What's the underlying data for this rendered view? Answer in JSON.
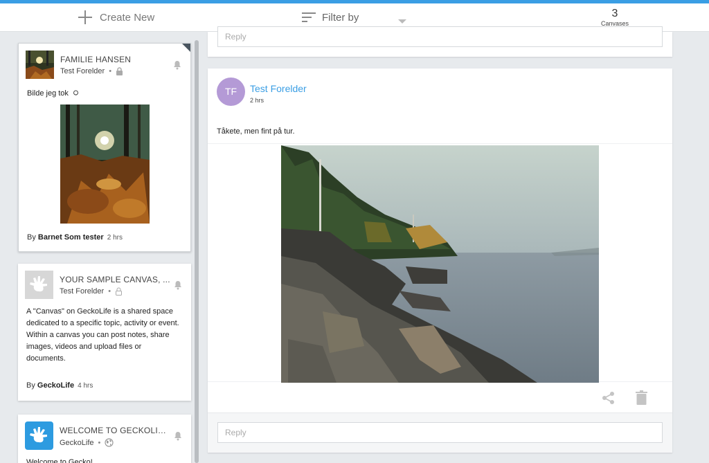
{
  "toolbar": {
    "create_new_label": "Create New",
    "filter_label": "Filter by",
    "canvas_count": "3",
    "canvas_count_label": "Canvases"
  },
  "canvases": [
    {
      "title": "FAMILIE HANSEN",
      "owner": "Test Forelder",
      "description": "Bilde jeg tok",
      "by_prefix": "By",
      "by_name": "Barnet Som tester",
      "age": "2 hrs"
    },
    {
      "title": "YOUR SAMPLE CANVAS, ...",
      "owner": "Test Forelder",
      "description": "A \"Canvas\" on GeckoLife is a shared space dedicated to a specific topic, activity or event. Within a canvas you can post notes, share images, videos and upload files or documents.",
      "by_prefix": "By",
      "by_name": "GeckoLife",
      "age": "4 hrs"
    },
    {
      "title": "WELCOME TO GECKOLIFE!",
      "owner": "GeckoLife",
      "description": "Welcome to Gecko!"
    }
  ],
  "feed": {
    "reply_placeholder": "Reply",
    "post": {
      "avatar_initials": "TF",
      "author": "Test Forelder",
      "time": "2 hrs",
      "text": "Tåkete, men fint på tur."
    }
  },
  "colors": {
    "accent": "#3a9ee4",
    "avatar": "#b49ad6"
  }
}
